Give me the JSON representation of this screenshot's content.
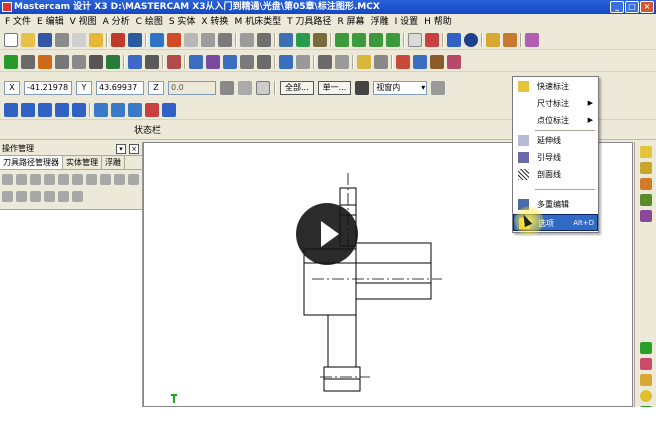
{
  "window": {
    "title": "Mastercam 设计 X3  D:\\MASTERCAM X3从入门到精通\\光盘\\第05章\\标注图形.MCX",
    "buttons": [
      "_",
      "□",
      "×"
    ]
  },
  "menubar": {
    "items": [
      "F 文件",
      "E 编辑",
      "V 视图",
      "A 分析",
      "C 绘图",
      "S 实体",
      "X 转换",
      "M 机床类型",
      "T 刀具路径",
      "R 屏幕",
      "浮雕",
      "I 设置",
      "H 帮助"
    ]
  },
  "coords": {
    "x_label": "X",
    "x_value": "-41.21978",
    "y_label": "Y",
    "y_value": "43.69937",
    "z_label": "Z",
    "z_value": "0.0",
    "all_button": "全部...",
    "single_button": "单一...",
    "view_select": "视窗内"
  },
  "status_label": "状态栏",
  "panel": {
    "title": "操作管理",
    "tabs": [
      "刀具路径管理器",
      "实体管理",
      "浮雕"
    ]
  },
  "dropdown": {
    "items": [
      {
        "label": "快速标注",
        "icon": "quick-dim-icon",
        "submenu": false
      },
      {
        "label": "尺寸标注",
        "icon": "",
        "submenu": true
      },
      {
        "label": "点位标注",
        "icon": "",
        "submenu": true
      },
      {
        "label": "延伸线",
        "icon": "extension-line-icon",
        "submenu": false
      },
      {
        "label": "引导线",
        "icon": "leader-line-icon",
        "submenu": false
      },
      {
        "label": "剖面线",
        "icon": "hatch-icon",
        "submenu": false
      },
      {
        "label": "多重编辑",
        "icon": "multi-edit-icon",
        "submenu": false
      },
      {
        "label": "选项",
        "icon": "options-icon",
        "submenu": false,
        "shortcut": "Alt+D",
        "highlighted": true
      }
    ]
  },
  "colors": {
    "title_blue": "#1347c4",
    "menu_highlight": "#316ac5",
    "ui_bg": "#ece9d8"
  }
}
